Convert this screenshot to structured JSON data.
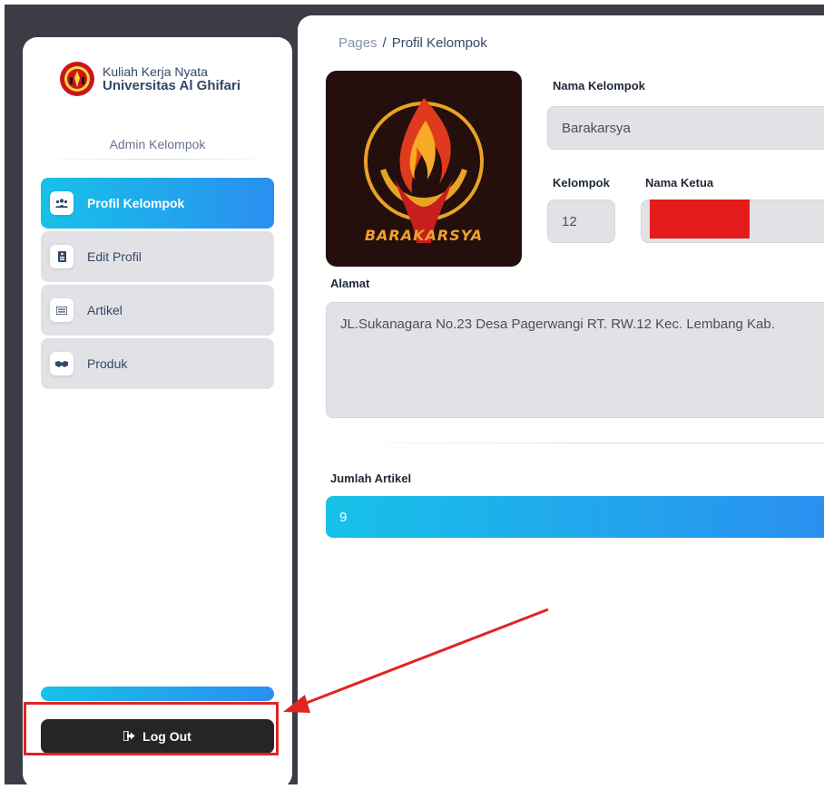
{
  "sidebar": {
    "brand_line1": "Kuliah Kerja Nyata",
    "brand_line2": "Universitas Al Ghifari",
    "role": "Admin Kelompok",
    "items": [
      {
        "label": "Profil Kelompok",
        "icon": "users-icon",
        "active": true
      },
      {
        "label": "Edit Profil",
        "icon": "id-card-icon",
        "active": false
      },
      {
        "label": "Artikel",
        "icon": "list-icon",
        "active": false
      },
      {
        "label": "Produk",
        "icon": "handshake-icon",
        "active": false
      }
    ],
    "logout_label": "Log Out"
  },
  "breadcrumb": {
    "root": "Pages",
    "separator": "/",
    "current": "Profil Kelompok"
  },
  "profile": {
    "logo_text": "BARAKARSYA",
    "nama_kelompok_label": "Nama Kelompok",
    "nama_kelompok_value": "Barakarsya",
    "kelompok_label": "Kelompok",
    "kelompok_value": "12",
    "nama_ketua_label": "Nama Ketua",
    "alamat_label": "Alamat",
    "alamat_value": "JL.Sukanagara No.23 Desa Pagerwangi RT.  RW.12  Kec.  Lembang Kab.",
    "jumlah_artikel_label": "Jumlah Artikel",
    "jumlah_artikel_value": "9"
  },
  "colors": {
    "accent_gradient_start": "#17c1e8",
    "accent_gradient_end": "#2a8ff0",
    "annotation": "#e02424",
    "redaction": "#e41b1b"
  }
}
